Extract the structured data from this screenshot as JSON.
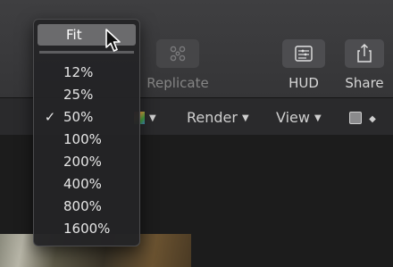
{
  "toolbar": {
    "replicate_label": "Replicate",
    "hud_label": "HUD",
    "share_label": "Share"
  },
  "viewer_bar": {
    "render_label": "Render",
    "view_label": "View"
  },
  "zoom_menu": {
    "fit_label": "Fit",
    "items": [
      "12%",
      "25%",
      "50%",
      "100%",
      "200%",
      "400%",
      "800%",
      "1600%"
    ],
    "checked_item": "50%",
    "checkmark": "✓"
  }
}
